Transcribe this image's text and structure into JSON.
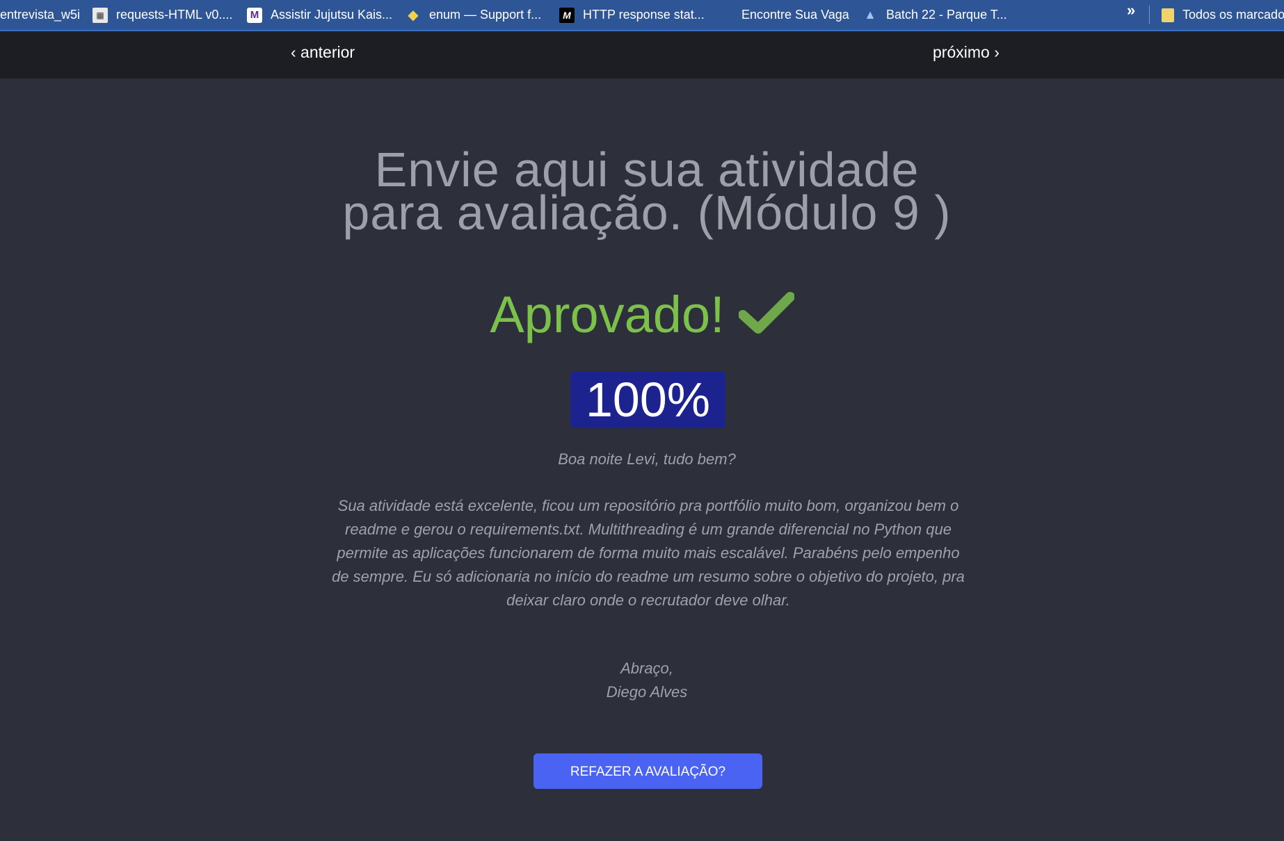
{
  "bookmarks": {
    "items": [
      {
        "label": "entrevista_w5i",
        "icon": "none"
      },
      {
        "label": "requests-HTML v0....",
        "icon": "document-icon"
      },
      {
        "label": "Assistir Jujutsu Kais...",
        "icon": "m-logo-icon"
      },
      {
        "label": "enum — Support f...",
        "icon": "python-icon"
      },
      {
        "label": "HTTP response stat...",
        "icon": "mdn-icon"
      },
      {
        "label": "Encontre Sua Vaga",
        "icon": "none"
      },
      {
        "label": "Batch 22 - Parque T...",
        "icon": "graduation-icon"
      }
    ],
    "overflow_label": "»",
    "all_bookmarks_label": "Todos os marcadores"
  },
  "nav": {
    "prev_label": "‹ anterior",
    "next_label": "próximo ›"
  },
  "content": {
    "title": "Envie aqui sua atividade para avaliação. (Módulo 9 )",
    "status": "Aprovado!",
    "score": "100%",
    "greeting": "Boa noite Levi, tudo bem?",
    "body": "Sua atividade está excelente, ficou um repositório pra portfólio muito bom, organizou bem o readme e  gerou o requirements.txt. Multithreading é um grande diferencial no Python que permite as aplicações funcionarem de forma muito mais escalável. Parabéns pelo empenho de sempre. Eu só adicionaria no início do readme um resumo sobre o objetivo do projeto, pra deixar claro onde o recrutador deve olhar.",
    "signoff_line1": "Abraço,",
    "signoff_line2": "Diego Alves",
    "redo_button": "REFAZER A AVALIAÇÃO?"
  },
  "colors": {
    "background": "#2d303b",
    "bookmarks_bar": "#2e5596",
    "navbar": "#1c1e24",
    "approved_green": "#7cc24a",
    "score_badge": "#1c238f",
    "button": "#4b63f2"
  }
}
